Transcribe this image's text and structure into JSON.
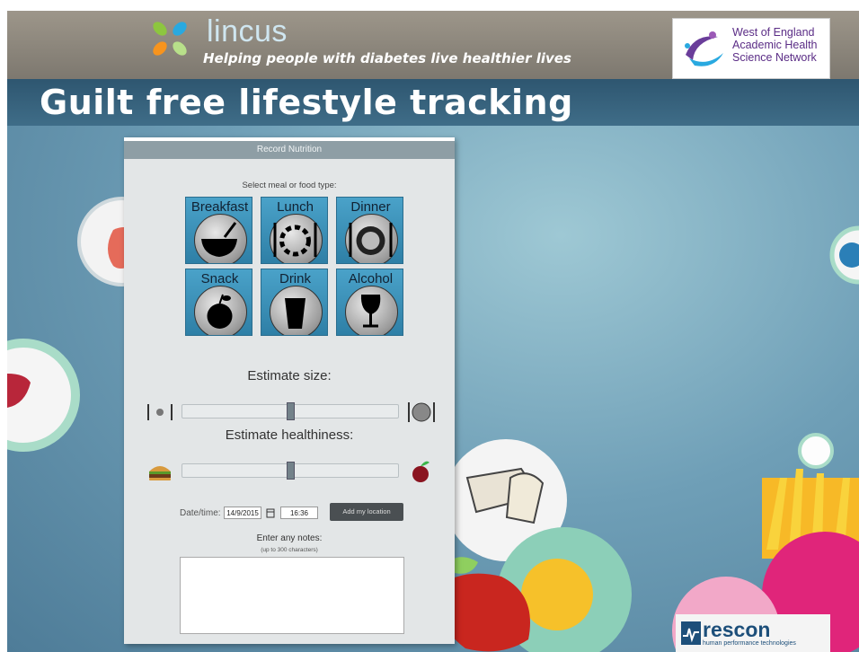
{
  "header": {
    "brand": "lincus",
    "tagline": "Helping people with diabetes live healthier lives",
    "partner_logo_text": [
      "West of England",
      "Academic Health",
      "Science Network"
    ]
  },
  "slide_title": "Guilt free lifestyle tracking",
  "panel": {
    "header": "Record Nutrition",
    "select_label": "Select meal or food type:",
    "meal_types": [
      {
        "label": "Breakfast",
        "icon": "bowl-icon"
      },
      {
        "label": "Lunch",
        "icon": "plate-lunch-icon"
      },
      {
        "label": "Dinner",
        "icon": "plate-dinner-icon"
      },
      {
        "label": "Snack",
        "icon": "apple-icon"
      },
      {
        "label": "Drink",
        "icon": "glass-icon"
      },
      {
        "label": "Alcohol",
        "icon": "wine-glass-icon"
      }
    ],
    "estimate_size": {
      "label": "Estimate size:",
      "value": 0.5
    },
    "estimate_healthiness": {
      "label": "Estimate healthiness:",
      "value": 0.5
    },
    "date_label": "Date/time:",
    "date_value": "14/9/2015",
    "time_value": "16:36",
    "location_button": "Add my location",
    "notes_label": "Enter any notes:",
    "notes_hint": "(up to 300 characters)",
    "notes_value": ""
  },
  "footer": {
    "logo_name": "rescon",
    "logo_sub": "human performance technologies"
  },
  "colors": {
    "tile": "#3a93bd",
    "title_band": "#36627d",
    "panel_header": "#8e9ea5"
  }
}
